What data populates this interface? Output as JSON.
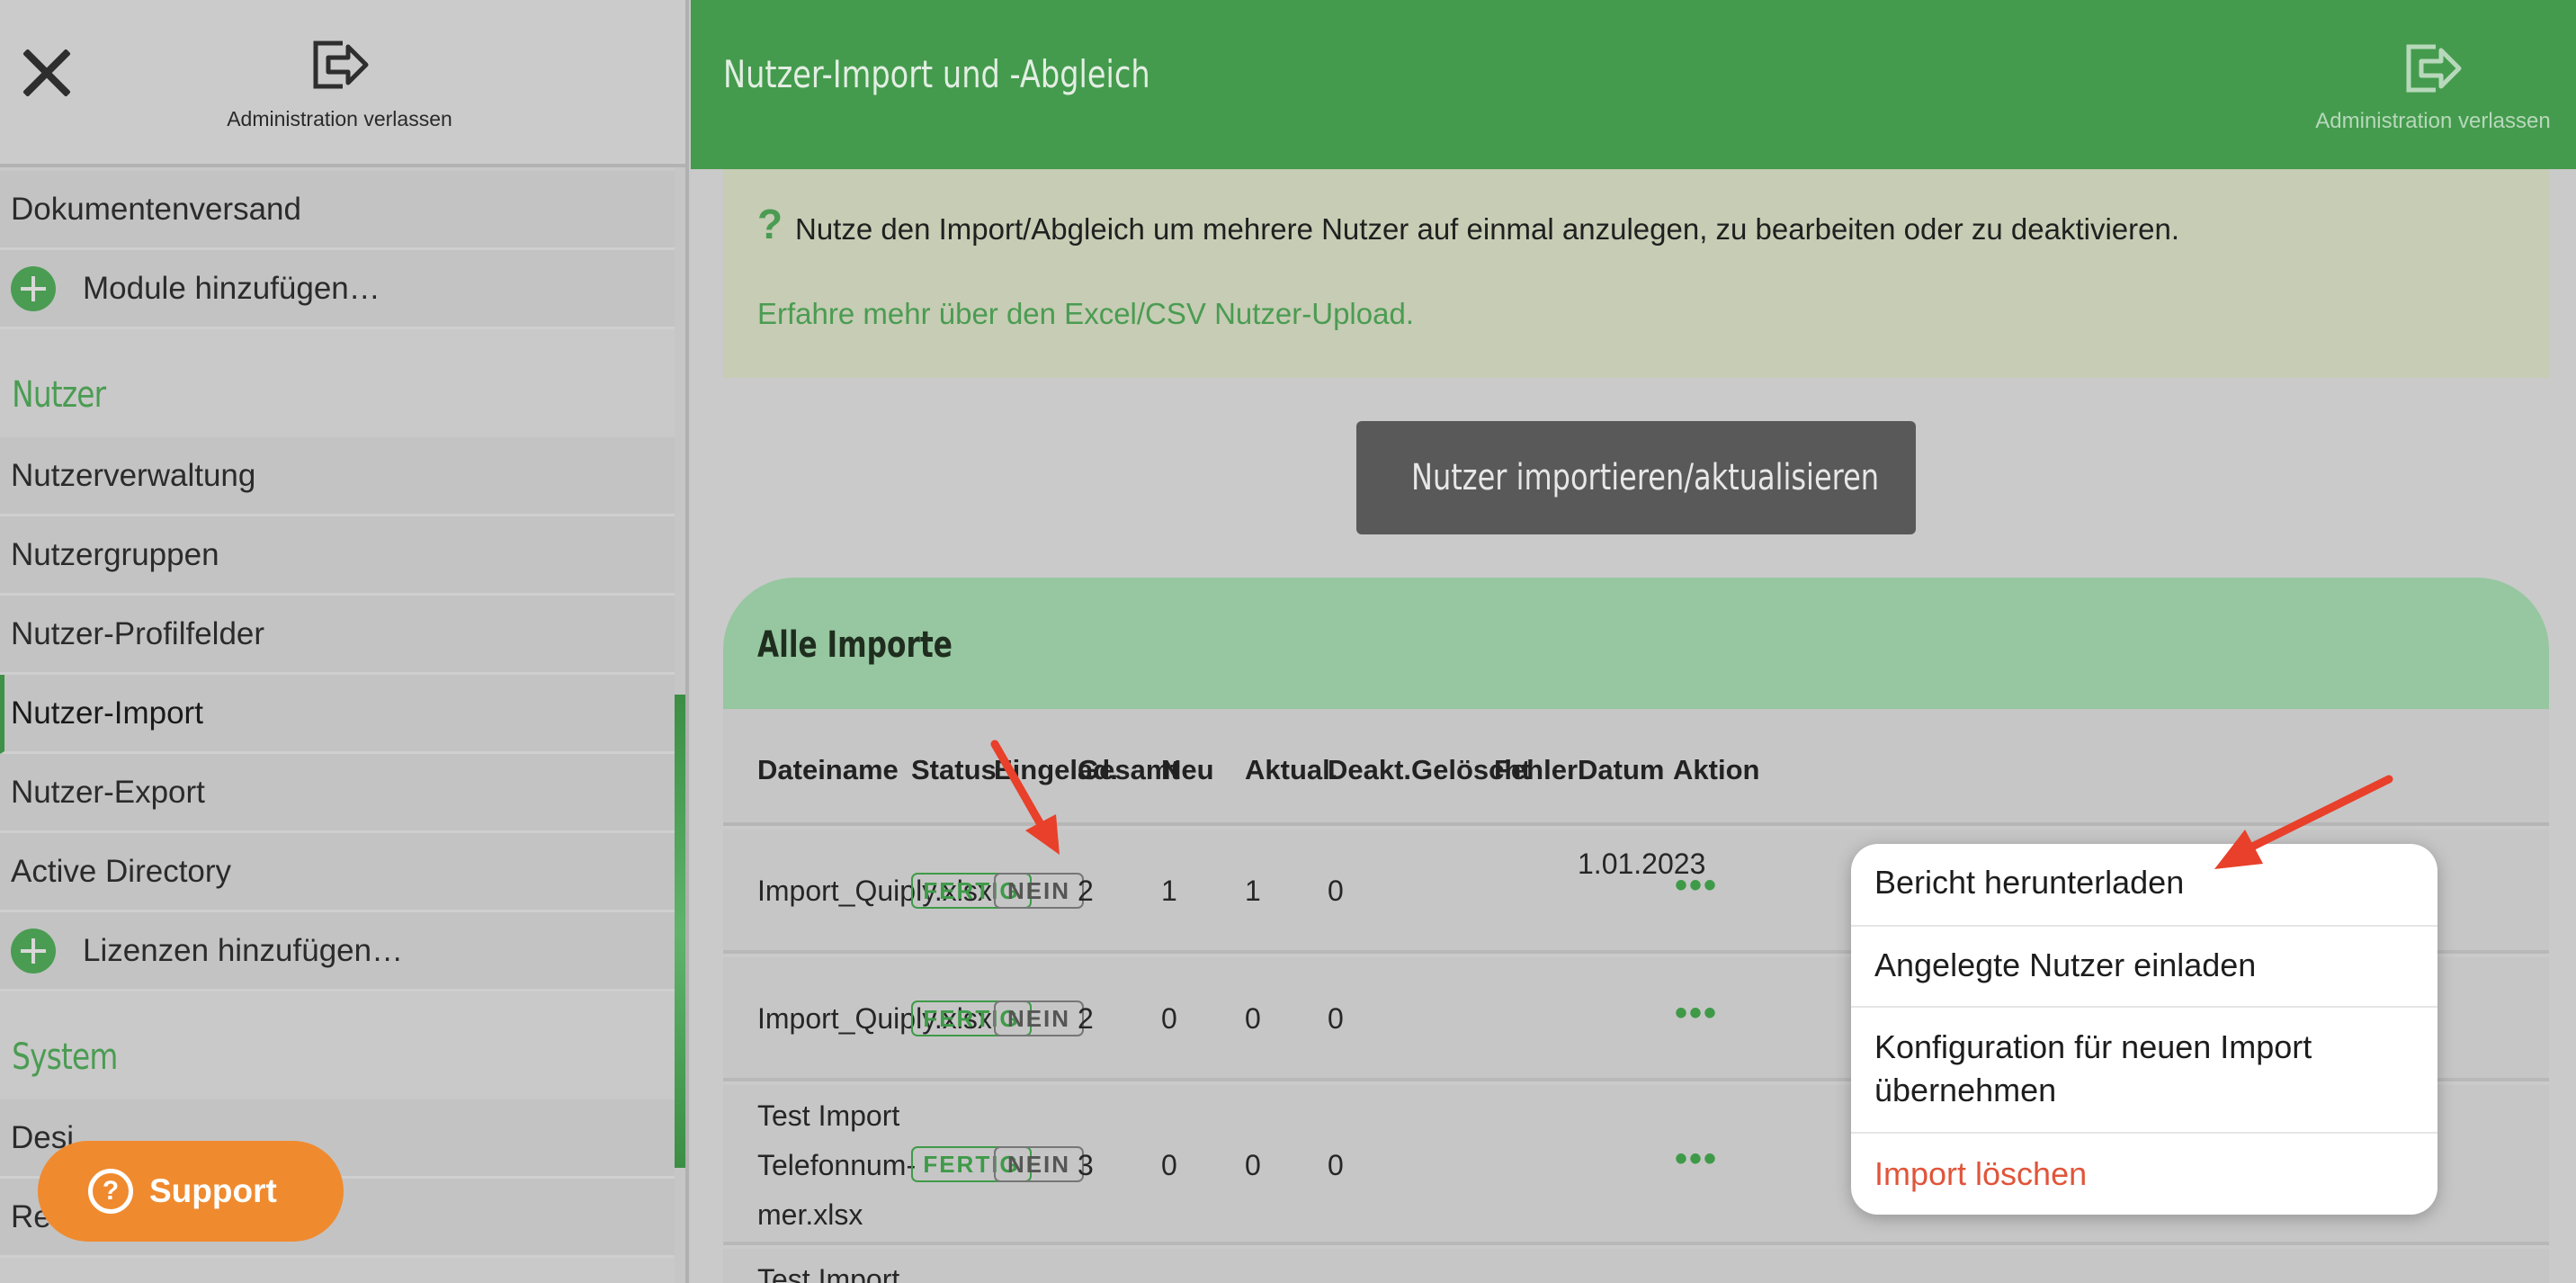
{
  "sidebar": {
    "close_label": "",
    "exit_label": "Administration verlassen",
    "items": [
      {
        "type": "item",
        "label": "Dokumentenversand"
      },
      {
        "type": "add",
        "label": "Module hinzufügen…"
      },
      {
        "type": "section",
        "label": "Nutzer"
      },
      {
        "type": "item",
        "label": "Nutzerverwaltung"
      },
      {
        "type": "item",
        "label": "Nutzergruppen"
      },
      {
        "type": "item",
        "label": "Nutzer-Profilfelder"
      },
      {
        "type": "item",
        "label": "Nutzer-Import",
        "active": true
      },
      {
        "type": "item",
        "label": "Nutzer-Export"
      },
      {
        "type": "item",
        "label": "Active Directory"
      },
      {
        "type": "add",
        "label": "Lizenzen hinzufügen…"
      },
      {
        "type": "section",
        "label": "System"
      },
      {
        "type": "item",
        "label": "Desi"
      },
      {
        "type": "item",
        "label": "Rec"
      }
    ]
  },
  "support": {
    "label": "Support",
    "icon": "question-circle-icon"
  },
  "header": {
    "title": "Nutzer-Import und -Abgleich",
    "exit_label": "Administration verlassen"
  },
  "info": {
    "text": "Nutze den Import/Abgleich um mehrere Nutzer auf einmal anzulegen, zu bearbeiten oder zu deaktivieren.",
    "link": "Erfahre mehr über den Excel/CSV Nutzer-Upload."
  },
  "import_button": {
    "label": "Nutzer importieren/aktualisieren",
    "icon": "cloud-upload-icon"
  },
  "imports": {
    "title": "Alle Importe",
    "columns": [
      "Dateiname",
      "Status",
      "Eingelad.",
      "Gesamt",
      "Neu",
      "Aktual.",
      "Deakt.",
      "Gelöscht",
      "Fehler",
      "Datum",
      "Aktion"
    ],
    "rows": [
      {
        "file": "Import_Quiply.xlsx",
        "status": "FERTIG",
        "invited": "NEIN",
        "total": "2",
        "new": "1",
        "updated": "1",
        "deact": "0",
        "date": "1.01.2023"
      },
      {
        "file": "Import_Quiply.xlsx",
        "status": "FERTIG",
        "invited": "NEIN",
        "total": "2",
        "new": "0",
        "updated": "0",
        "deact": "0"
      },
      {
        "file_lines": [
          "Test Import",
          "Telefonnum-",
          "mer.xlsx"
        ],
        "status": "FERTIG",
        "invited": "NEIN",
        "total": "3",
        "new": "0",
        "updated": "0",
        "deact": "0"
      },
      {
        "file": "Test Import"
      }
    ],
    "action_label": "•••"
  },
  "menu": {
    "items": [
      "Bericht herunterladen",
      "Angelegte Nutzer einladen",
      "Konfiguration für neuen Import übernehmen",
      "Import löschen"
    ]
  },
  "colors": {
    "brand_green": "#449b4d",
    "support_orange": "#f08a2e",
    "danger": "#e0553a",
    "annotation_arrow": "#e8402a"
  }
}
